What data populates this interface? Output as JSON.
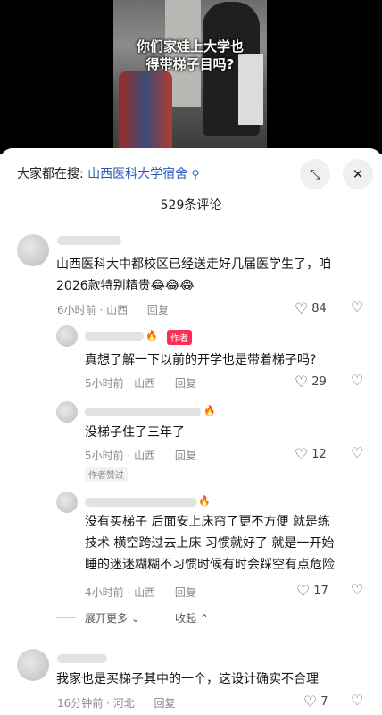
{
  "video": {
    "caption_line1": "你们家娃上大学也",
    "caption_line2": "得带梯子目吗?"
  },
  "search": {
    "prefix": "大家都在搜:",
    "query": "山西医科大学宿舍",
    "icon": "search-icon"
  },
  "header": {
    "comment_count": "529条评论",
    "minimize_icon": "minimize-icon",
    "close_icon": "close-icon",
    "close_glyph": "✕"
  },
  "comments": [
    {
      "text_line1": "山西医科大中都校区已经送走好几届医学生了，咱",
      "text_line2": "2026款特别精贵😂😂😂",
      "time_loc": "6小时前 · 山西",
      "reply": "回复",
      "likes": "84"
    },
    {
      "author_tag": "作者",
      "text": "真想了解一下以前的开学也是带着梯子吗?",
      "time_loc": "5小时前 · 山西",
      "reply": "回复",
      "likes": "29"
    },
    {
      "text": "没梯子住了三年了",
      "time_loc": "5小时前 · 山西",
      "reply": "回复",
      "likes": "12",
      "badge": "作者赞过"
    },
    {
      "text_line1": "没有买梯子 后面安上床帘了更不方便 就是练",
      "text_line2": "技术 横空跨过去上床 习惯就好了 就是一开始",
      "text_line3": "睡的迷迷糊糊不习惯时候有时会踩空有点危险",
      "time_loc": "4小时前 · 山西",
      "reply": "回复",
      "likes": "17"
    },
    {
      "text": "我家也是买梯子其中的一个，这设计确实不合理",
      "time_loc": "16分钟前 · 河北",
      "reply": "回复",
      "likes": "7"
    }
  ],
  "thread_controls": {
    "expand": "展开更多",
    "collapse": "收起"
  }
}
